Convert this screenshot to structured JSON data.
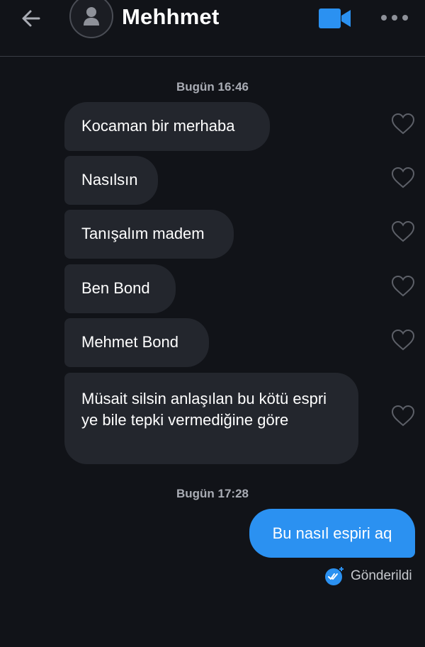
{
  "header": {
    "contact_name": "Mehhmet",
    "icons": {
      "back": "arrow-left-icon",
      "avatar": "person-icon",
      "video": "video-camera-icon",
      "more": "ellipsis-icon"
    }
  },
  "conversation": {
    "date_1": "Bugün 16:46",
    "received": [
      "Kocaman bir merhaba",
      "Nasılsın",
      "Tanışalım madem",
      "Ben Bond",
      "Mehmet Bond",
      "Müsait silsin anlaşılan bu kötü espri ye bile tepki vermediğine göre"
    ],
    "date_2": "Bugün 17:28",
    "sent": {
      "text": "Bu nasıl espiri aq",
      "status": "Gönderildi",
      "status_icon": "double-check-icon"
    }
  },
  "colors": {
    "background": "#111318",
    "received_bubble": "#23262d",
    "sent_bubble": "#2b91f1",
    "accent": "#2b91f1"
  }
}
